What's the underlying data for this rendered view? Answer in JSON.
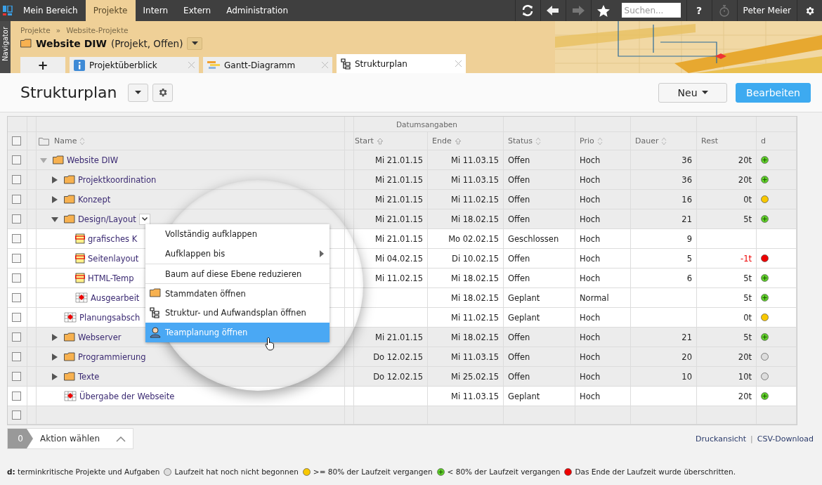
{
  "top_nav": {
    "tabs": [
      {
        "label": "Mein Bereich",
        "selected": false
      },
      {
        "label": "Projekte",
        "selected": true
      },
      {
        "label": "Intern",
        "selected": false
      },
      {
        "label": "Extern",
        "selected": false
      },
      {
        "label": "Administration",
        "selected": false
      }
    ],
    "search": {
      "placeholder": "Suchen..."
    },
    "help": "?",
    "user": "Peter Meier"
  },
  "navigator": {
    "label": "Navigator"
  },
  "breadcrumb": {
    "items": [
      "Projekte",
      "Website-Projekte"
    ],
    "separator": "»"
  },
  "project": {
    "name": "Website DIW",
    "info": "(Projekt, Offen)"
  },
  "doc_tabs": {
    "add": "+",
    "tabs": [
      {
        "label": "Projektüberblick",
        "kind": "info",
        "selected": false
      },
      {
        "label": "Gantt-Diagramm",
        "kind": "gantt",
        "selected": false
      },
      {
        "label": "Strukturplan",
        "kind": "tree",
        "selected": true
      }
    ]
  },
  "page": {
    "title": "Strukturplan",
    "buttons": [
      {
        "label": "Neu",
        "kind": "dropdown"
      },
      {
        "label": "Bearbeiten",
        "kind": "primary"
      }
    ]
  },
  "table": {
    "group_header": "Datumsangaben",
    "select_all_checked": false,
    "columns": [
      {
        "label": "Name",
        "kind": "sortable"
      },
      {
        "label": "Start",
        "kind": "sorted"
      },
      {
        "label": "Ende",
        "kind": "sorted"
      },
      {
        "label": "Status",
        "kind": "sortable"
      },
      {
        "label": "Prio",
        "kind": "sortable"
      },
      {
        "label": "Dauer",
        "kind": "sortable"
      },
      {
        "label": "Rest",
        "kind": "plain"
      },
      {
        "label": "d",
        "kind": "plain"
      }
    ],
    "rows": [
      {
        "name": "Website DIW",
        "kind": "project",
        "expanded": true,
        "checked": false,
        "start": "Mi 21.01.15",
        "end": "Mi 11.03.15",
        "status": "Offen",
        "prio": "Hoch",
        "dauer": "36",
        "rest": "20t",
        "color": "#5fce2a",
        "children": [
          {
            "name": "Projektkoordination",
            "kind": "folder",
            "expanded": false,
            "checked": false,
            "start": "Mi 21.01.15",
            "end": "Mi 11.03.15",
            "status": "Offen",
            "prio": "Hoch",
            "dauer": "36",
            "rest": "20t",
            "color": "#5fce2a"
          },
          {
            "name": "Konzept",
            "kind": "folder",
            "expanded": false,
            "checked": false,
            "start": "Mi 21.01.15",
            "end": "Mi 11.02.15",
            "status": "Offen",
            "prio": "Hoch",
            "dauer": "16",
            "rest": "0t",
            "color": "#f8c800"
          },
          {
            "name": "Design/Layout",
            "kind": "folder",
            "expanded": true,
            "checked": false,
            "menu_open": true,
            "start": "Mi 21.01.15",
            "end": "Mi 18.02.15",
            "status": "Offen",
            "prio": "Hoch",
            "dauer": "21",
            "rest": "5t",
            "color": "#5fce2a",
            "children": [
              {
                "name": "grafisches K",
                "kind": "task",
                "checked": false,
                "start": "Mi 21.01.15",
                "end": "Mo 02.02.15",
                "status": "Geschlossen",
                "prio": "Hoch",
                "dauer": "9"
              },
              {
                "name": "Seitenlayout",
                "kind": "task",
                "checked": false,
                "overdue": true,
                "start": "Mi 04.02.15",
                "end": "Di 10.02.15",
                "status": "Offen",
                "prio": "Hoch",
                "dauer": "5",
                "rest": "-1t",
                "color": "#ee0000"
              },
              {
                "name": "HTML-Temp",
                "kind": "task",
                "checked": false,
                "start": "Mi 11.02.15",
                "end": "Mi 18.02.15",
                "status": "Offen",
                "prio": "Hoch",
                "dauer": "6",
                "rest": "5t",
                "color": "#5fce2a"
              },
              {
                "name": "Ausgearbeit",
                "kind": "milestone",
                "checked": false,
                "end": "Mi 18.02.15",
                "status": "Geplant",
                "prio": "Normal",
                "rest": "5t",
                "color": "#5fce2a"
              }
            ]
          },
          {
            "name": "Planungsabsch",
            "kind": "milestone",
            "checked": false,
            "end": "Mi 11.02.15",
            "status": "Geplant",
            "prio": "Hoch",
            "rest": "0t",
            "color": "#f8c800"
          },
          {
            "name": "Webserver",
            "kind": "folder",
            "expanded": false,
            "checked": false,
            "start": "Mi 21.01.15",
            "end": "Mi 18.02.15",
            "status": "Offen",
            "prio": "Hoch",
            "dauer": "21",
            "rest": "5t",
            "color": "#5fce2a"
          },
          {
            "name": "Programmierung",
            "kind": "folder",
            "expanded": false,
            "checked": false,
            "start": "Do 12.02.15",
            "end": "Mi 11.03.15",
            "status": "Offen",
            "prio": "Hoch",
            "dauer": "20",
            "rest": "20t",
            "color": "#dddddd"
          },
          {
            "name": "Texte",
            "kind": "folder",
            "expanded": false,
            "checked": false,
            "start": "Do 12.02.15",
            "end": "Mi 25.02.15",
            "status": "Offen",
            "prio": "Hoch",
            "dauer": "10",
            "rest": "10t",
            "color": "#dddddd"
          },
          {
            "name": "Übergabe der Webseite",
            "kind": "milestone",
            "checked": false,
            "end": "Mi 11.03.15",
            "status": "Geplant",
            "prio": "Hoch",
            "rest": "20t",
            "color": "#5fce2a"
          }
        ]
      }
    ],
    "empty_row_checked": false
  },
  "context_menu": {
    "items": [
      {
        "label": "Vollständig aufklappen",
        "kind": "plain",
        "submenu": false,
        "separator_before": false,
        "selected": false
      },
      {
        "label": "Aufklappen bis",
        "kind": "plain",
        "submenu": true,
        "separator_before": false,
        "selected": false
      },
      {
        "label": "Baum auf diese Ebene reduzieren",
        "kind": "plain",
        "submenu": false,
        "separator_before": true,
        "selected": false
      },
      {
        "label": "Stammdaten öffnen",
        "kind": "folder",
        "submenu": false,
        "separator_before": true,
        "selected": false
      },
      {
        "label": "Struktur- und Aufwandsplan öffnen",
        "kind": "tree",
        "submenu": false,
        "separator_before": false,
        "selected": false
      },
      {
        "label": "Teamplanung öffnen",
        "kind": "person",
        "submenu": false,
        "separator_before": false,
        "selected": true
      }
    ]
  },
  "footer": {
    "selected_count": "0",
    "action": "Aktion wählen",
    "links": [
      "Druckansicht",
      "CSV-Download"
    ],
    "link_separator": "|"
  },
  "legend": {
    "text": "**d:** terminkritische Projekte und Aufgaben",
    "items": [
      {
        "color": "#dddddd",
        "label": "Laufzeit hat noch nicht begonnen"
      },
      {
        "color": "#f8c800",
        "label": ">= 80% der Laufzeit vergangen"
      },
      {
        "color": "#5fce2a",
        "label": "< 80% der Laufzeit vergangen"
      },
      {
        "color": "#ee0000",
        "label": "Das Ende der Laufzeit wurde überschritten."
      }
    ]
  }
}
